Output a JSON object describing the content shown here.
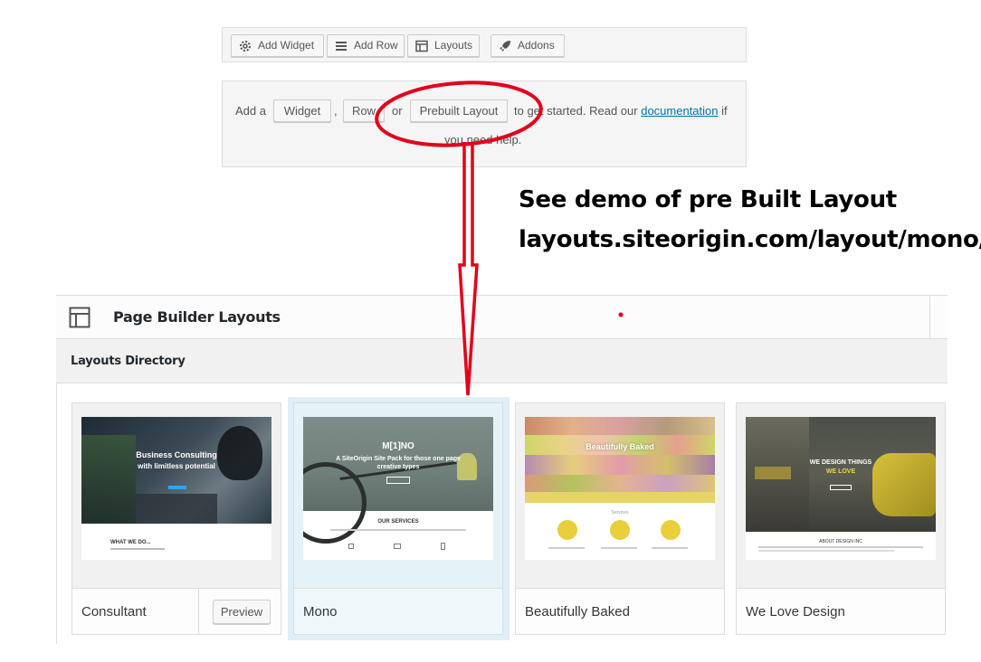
{
  "toolbar": {
    "buttons": [
      {
        "label": "Add Widget",
        "icon": "gear-icon"
      },
      {
        "label": "Add Row",
        "icon": "rows-icon"
      },
      {
        "label": "Layouts",
        "icon": "layout-icon"
      },
      {
        "label": "Addons",
        "icon": "rocket-icon"
      }
    ]
  },
  "empty_panel": {
    "add_a": "Add a",
    "widget_btn": "Widget",
    "comma": ",",
    "row_btn": "Row",
    "or": "or",
    "prebuilt_btn": "Prebuilt Layout",
    "get_started": "to get started. Read our",
    "doc_link": "documentation",
    "if_text": "if",
    "need_help": "you need help."
  },
  "annotation": {
    "line1": "See demo of pre Built Layout",
    "line2": "layouts.siteorigin.com/layout/mono/",
    "color": "#e3001b"
  },
  "modal": {
    "title": "Page Builder Layouts",
    "directory_title": "Layouts Directory",
    "preview_label": "Preview",
    "cards": [
      {
        "name": "Consultant",
        "thumb_heading": "Business Consulting",
        "thumb_sub": "with limitless potential",
        "thumb_section": "WHAT WE DO..."
      },
      {
        "name": "Mono",
        "thumb_heading": "M[1]NO",
        "thumb_sub": "A SiteOrigin Site Pack for those one page creative types",
        "thumb_section": "OUR SERVICES"
      },
      {
        "name": "Beautifully Baked",
        "thumb_heading": "Beautifully Baked",
        "thumb_section": "Services"
      },
      {
        "name": "We Love Design",
        "thumb_heading": "WE DESIGN THINGS",
        "thumb_sub": "WE LOVE",
        "thumb_section": "ABOUT DESIGN INC"
      }
    ]
  }
}
